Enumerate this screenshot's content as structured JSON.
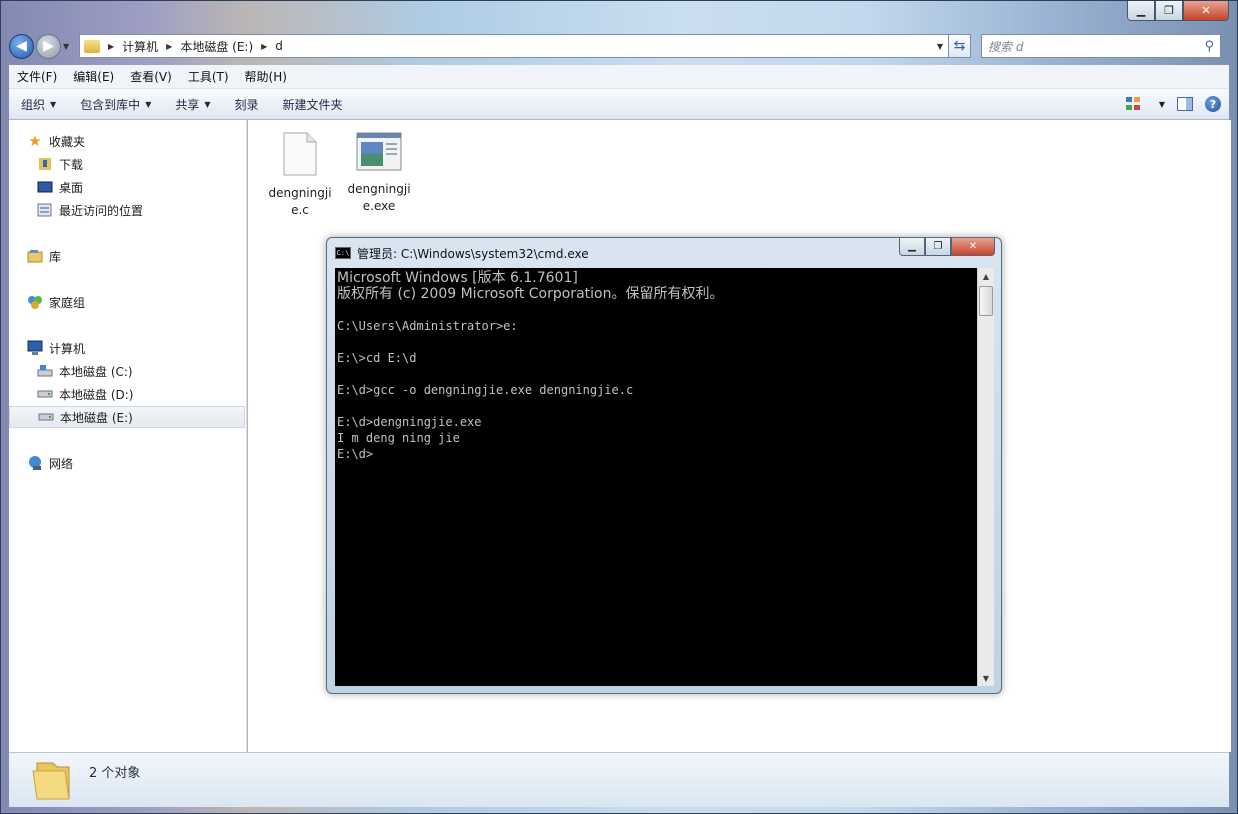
{
  "explorer": {
    "breadcrumb": [
      "计算机",
      "本地磁盘 (E:)",
      "d"
    ],
    "search_placeholder": "搜索 d",
    "menu": [
      "文件(F)",
      "编辑(E)",
      "查看(V)",
      "工具(T)",
      "帮助(H)"
    ],
    "commands": [
      {
        "label": "组织",
        "has_caret": true
      },
      {
        "label": "包含到库中",
        "has_caret": true
      },
      {
        "label": "共享",
        "has_caret": true
      },
      {
        "label": "刻录",
        "has_caret": false
      },
      {
        "label": "新建文件夹",
        "has_caret": false
      }
    ],
    "nav": {
      "favorites": "收藏夹",
      "downloads": "下载",
      "desktop": "桌面",
      "recent": "最近访问的位置",
      "libraries": "库",
      "homegroup": "家庭组",
      "computer": "计算机",
      "drive_c": "本地磁盘 (C:)",
      "drive_d": "本地磁盘 (D:)",
      "drive_e": "本地磁盘 (E:)",
      "network": "网络"
    },
    "files": [
      {
        "name": "dengningjie.c",
        "icon": "c-file-icon"
      },
      {
        "name": "dengningjie.exe",
        "icon": "exe-file-icon"
      }
    ],
    "status": "2 个对象"
  },
  "cmd": {
    "title": "管理员: C:\\Windows\\system32\\cmd.exe",
    "icon_text": "C:\\",
    "lines": [
      "Microsoft Windows [版本 6.1.7601]",
      "版权所有 (c) 2009 Microsoft Corporation。保留所有权利。",
      "",
      "C:\\Users\\Administrator>e:",
      "",
      "E:\\>cd E:\\d",
      "",
      "E:\\d>gcc -o dengningjie.exe dengningjie.c",
      "",
      "E:\\d>dengningjie.exe",
      "I m deng ning jie",
      "E:\\d>"
    ]
  }
}
